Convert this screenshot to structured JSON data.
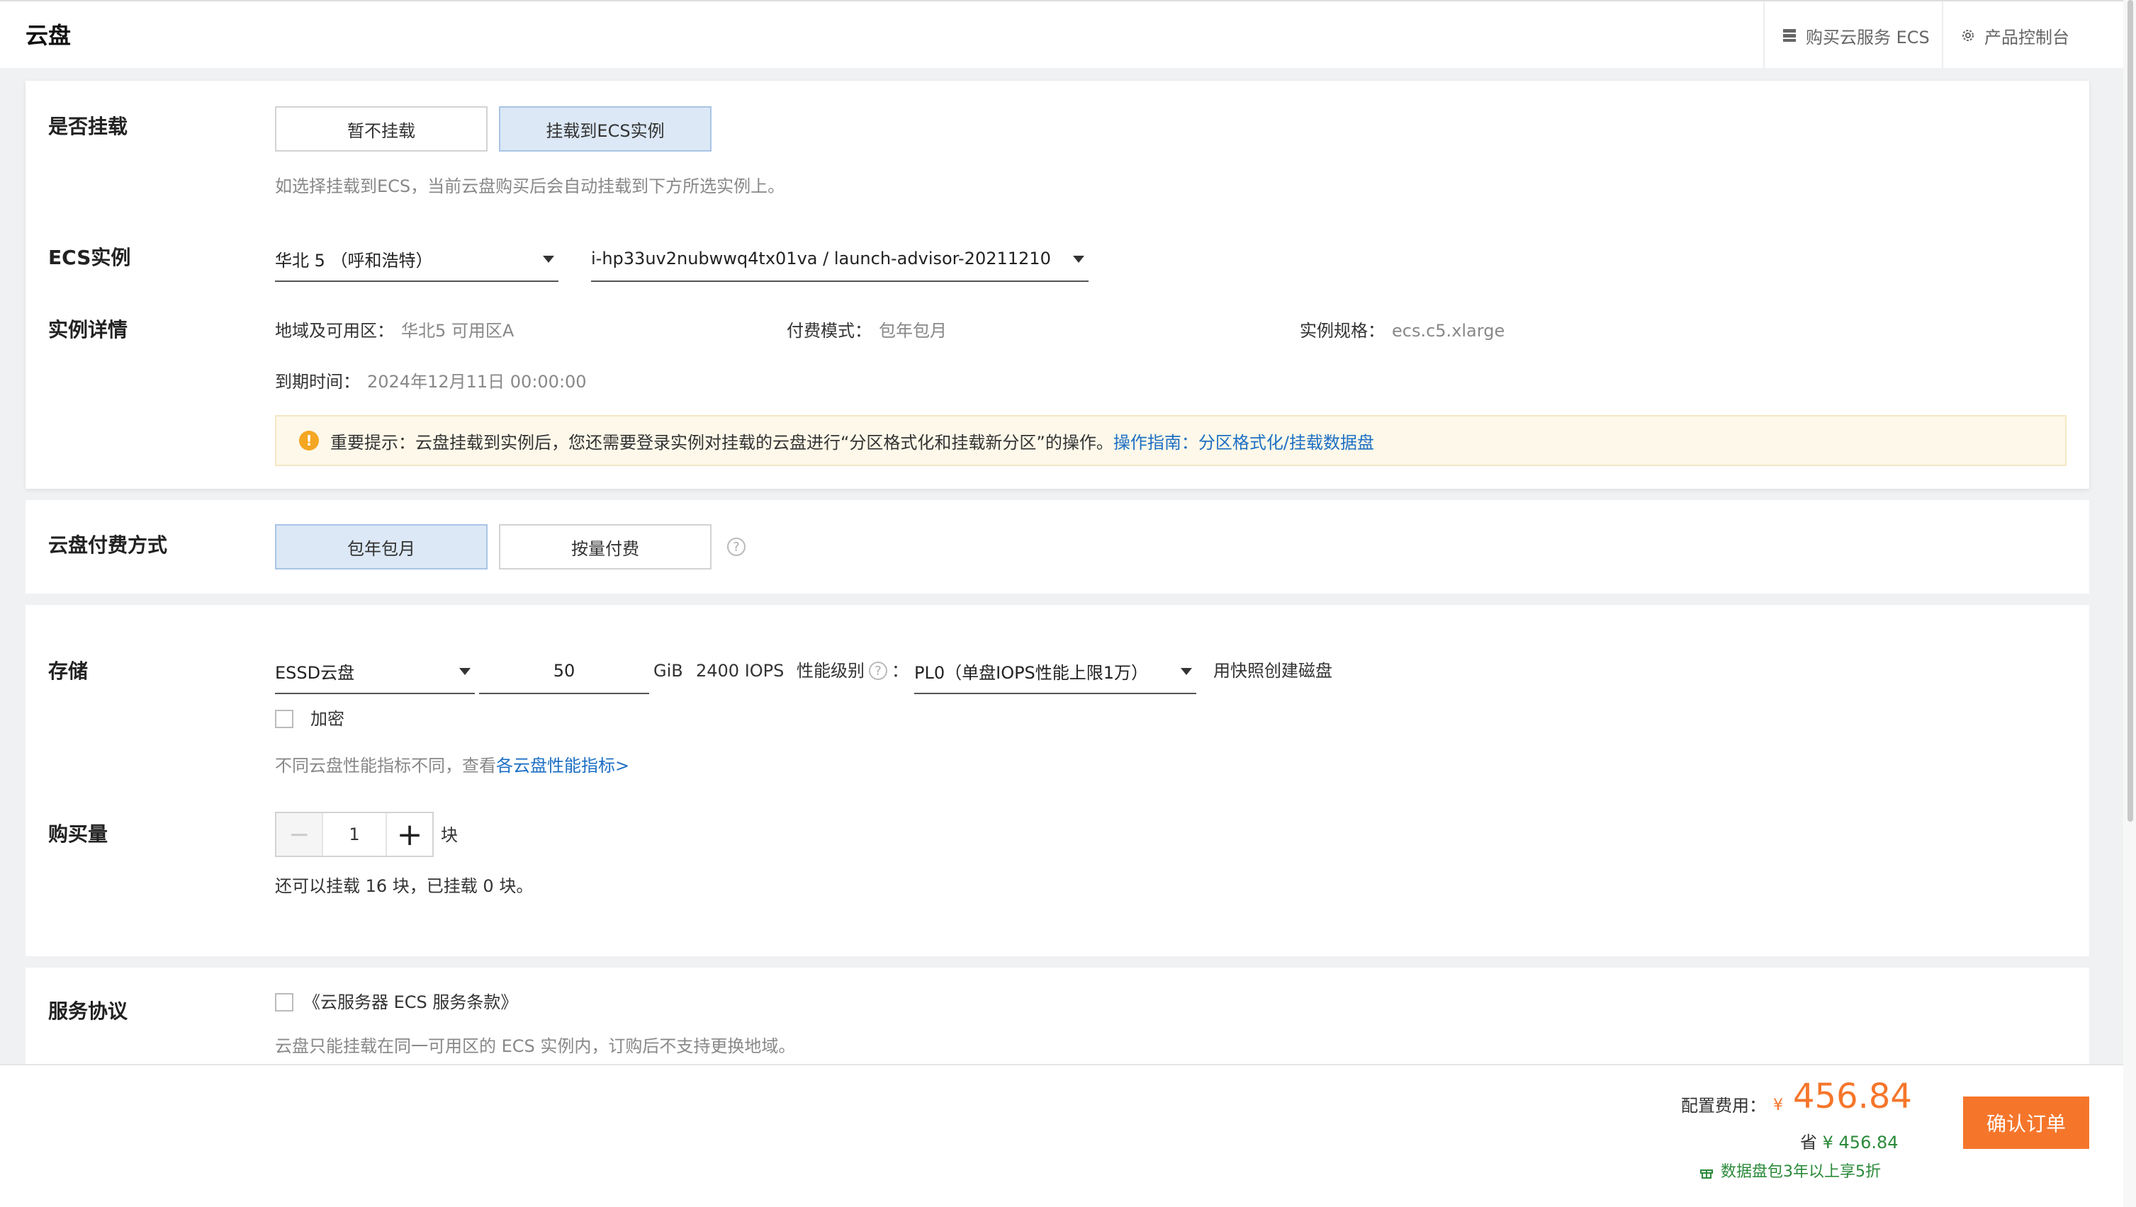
{
  "header": {
    "title": "云盘",
    "buy_ecs_label": "购买云服务 ECS",
    "console_label": "产品控制台"
  },
  "mount": {
    "label": "是否挂载",
    "options": [
      "暂不挂载",
      "挂载到ECS实例"
    ],
    "selected": "挂载到ECS实例",
    "hint": "如选择挂载到ECS，当前云盘购买后会自动挂载到下方所选实例上。"
  },
  "ecs": {
    "label": "ECS实例",
    "region_value": "华北 5 （呼和浩特）",
    "instance_value": "i-hp33uv2nubwwq4tx01va / launch-advisor-20211210"
  },
  "details": {
    "label": "实例详情",
    "zone_key": "地域及可用区：",
    "zone_val": "华北5 可用区A",
    "billing_key": "付费模式：",
    "billing_val": "包年包月",
    "spec_key": "实例规格：",
    "spec_val": "ecs.c5.xlarge",
    "expire_key": "到期时间：",
    "expire_val": "2024年12月11日 00:00:00",
    "notice_text": "重要提示：云盘挂载到实例后，您还需要登录实例对挂载的云盘进行“分区格式化和挂载新分区”的操作。",
    "notice_link": "操作指南：分区格式化/挂载数据盘"
  },
  "payment": {
    "label": "云盘付费方式",
    "options": [
      "包年包月",
      "按量付费"
    ],
    "selected": "包年包月"
  },
  "storage": {
    "label": "存储",
    "disk_type": "ESSD云盘",
    "size": "50",
    "unit": "GiB",
    "iops": "2400 IOPS",
    "perf_label": "性能级别",
    "perf_colon": "：",
    "perf_value": "PL0（单盘IOPS性能上限1万）",
    "snapshot_link": "用快照创建磁盘",
    "encrypt_label": "加密",
    "encrypt_checked": false,
    "perf_hint": "不同云盘性能指标不同，查看",
    "perf_link": "各云盘性能指标>"
  },
  "quantity": {
    "label": "购买量",
    "value": "1",
    "unit": "块",
    "minus": "−",
    "plus": "+",
    "hint": "还可以挂载 16 块，已挂载 0 块。"
  },
  "agreement": {
    "label": "服务协议",
    "link": "《云服务器 ECS 服务条款》",
    "checked": false,
    "hint": "云盘只能挂载在同一可用区的 ECS 实例内，订购后不支持更换地域。"
  },
  "footer": {
    "fee_label": "配置费用：",
    "currency": "¥",
    "amount": "456.84",
    "save_label": "省",
    "save_amount": "¥ 456.84",
    "promo": "数据盘包3年以上享5折",
    "confirm": "确认订单"
  },
  "icons": {
    "buy": "server-icon",
    "console": "gear-icon",
    "warning": "warning-icon",
    "help": "help-icon",
    "gift": "gift-icon"
  },
  "colors": {
    "accent": "#f5762b",
    "link": "#1d6fc4",
    "active_segment": "#dce8f6",
    "notice_bg": "#fdf8e9",
    "promo": "#2a8a3a"
  }
}
